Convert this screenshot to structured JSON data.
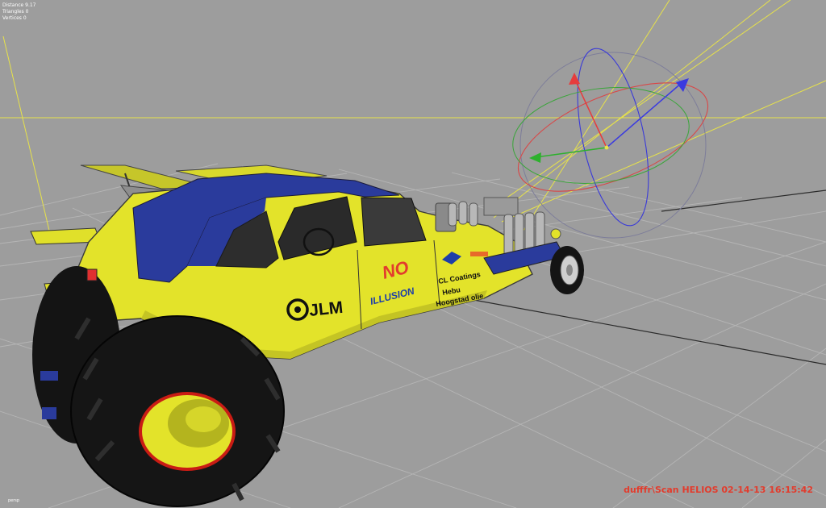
{
  "stats": {
    "distance": "Distance 9.17",
    "triangles": "Triangles 0",
    "vertices": "Vertices 0"
  },
  "corner_label": "persp",
  "watermark": "dufffr\\Scan HELIOS 02-14-13 16:15:42",
  "decals": {
    "jlm": "JLM",
    "no": "NO",
    "illusion": "ILLUSION",
    "cl_coatings": "CL Coatings",
    "hebu": "Hebu",
    "hoogstad": "Hoogstad olie"
  },
  "colors": {
    "background": "#9d9d9d",
    "car_body": "#e3e32a",
    "car_roof": "#2a3b9c",
    "tire": "#121212",
    "watermark": "#e23c2d",
    "axis_x": "#e63c3c",
    "axis_y": "#2db12d",
    "axis_z": "#3a3ae0"
  },
  "icons": {
    "gizmo": "rotate-gizmo-icon"
  }
}
